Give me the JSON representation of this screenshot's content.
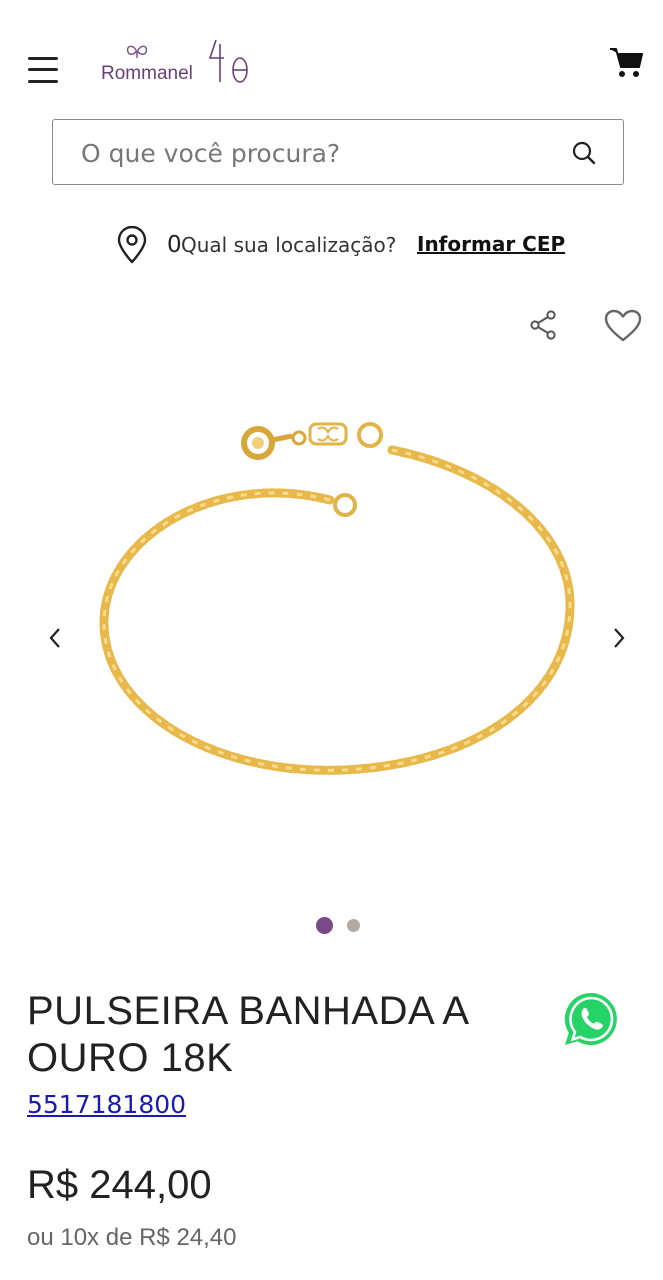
{
  "header": {
    "brand": "Rommanel",
    "anniversary_mark": "40"
  },
  "search": {
    "placeholder": "O que você procura?"
  },
  "location": {
    "count": "0",
    "prompt": "Qual sua localização?",
    "link": "Informar CEP"
  },
  "product": {
    "title": "PULSEIRA BANHADA A OURO 18K",
    "sku": "5517181800",
    "price": "R$ 244,00",
    "installments": "ou 10x de R$ 24,40",
    "carousel_total": 2,
    "carousel_active": 1
  },
  "colors": {
    "accent": "#7a4a86",
    "whatsapp": "#25d366",
    "gold": "#e8b84a",
    "link": "#1a1ab5"
  },
  "icons": {
    "menu": "hamburger-menu-icon",
    "cart": "cart-icon",
    "search": "search-icon",
    "location": "map-pin-icon",
    "share": "share-icon",
    "favorite": "heart-icon",
    "prev": "chevron-left-icon",
    "next": "chevron-right-icon",
    "chat": "whatsapp-icon"
  }
}
